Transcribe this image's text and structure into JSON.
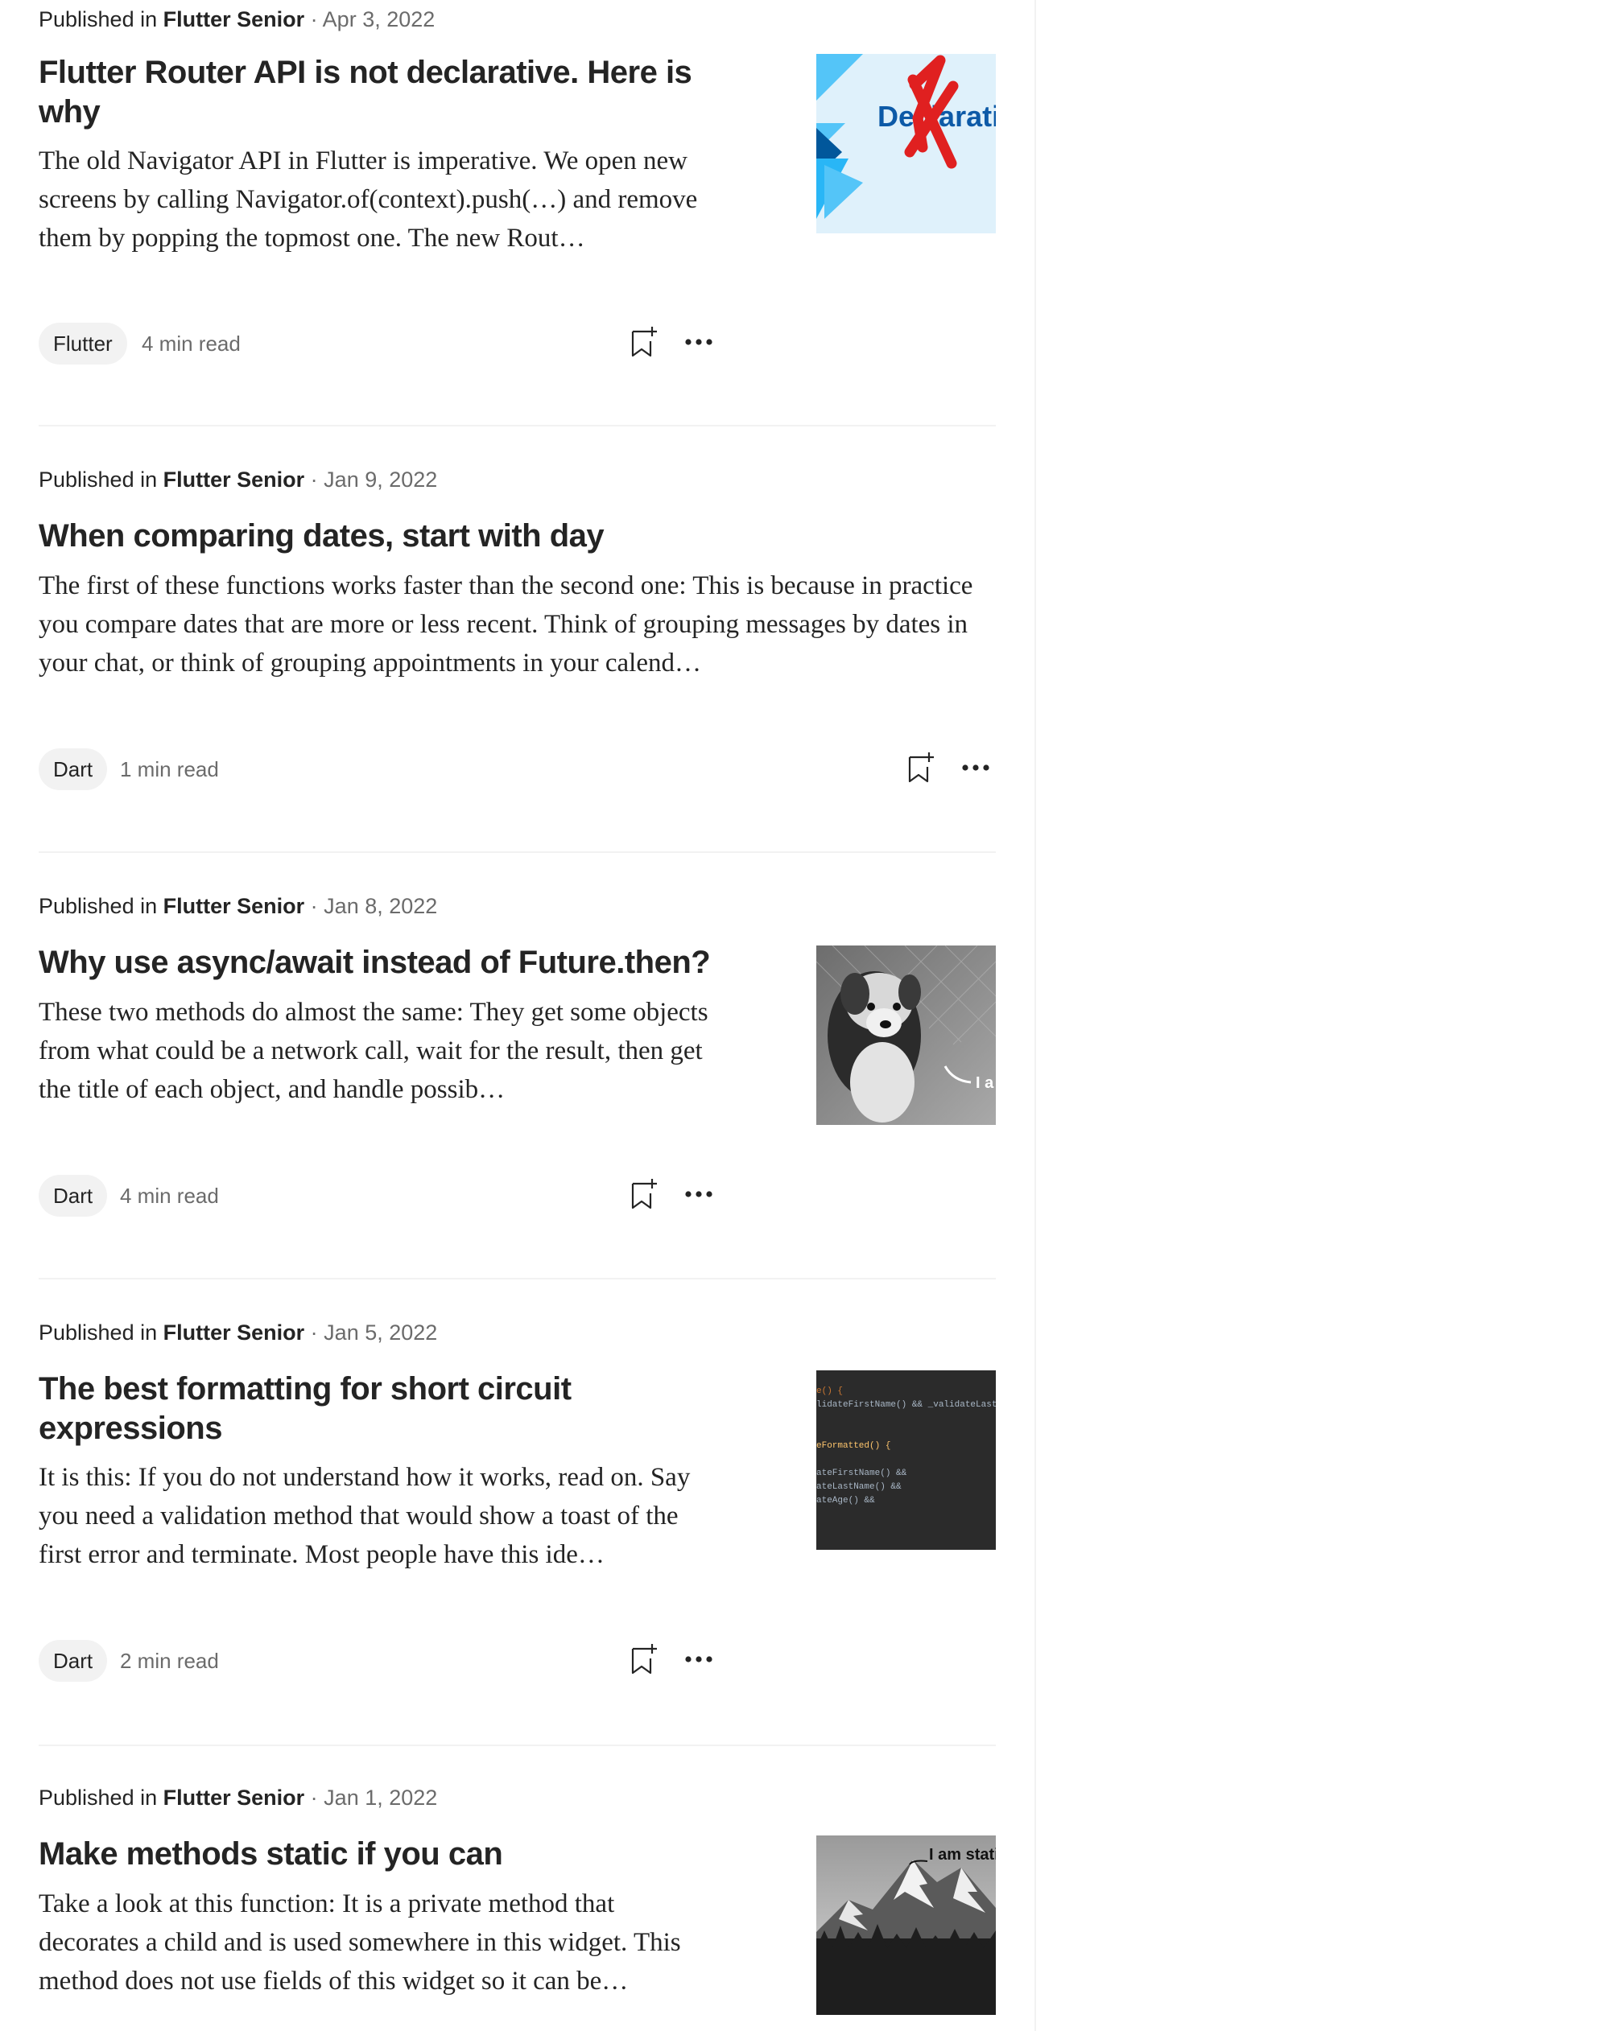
{
  "articles": [
    {
      "published_prefix": "Published in",
      "publication": "Flutter Senior",
      "separator": "·",
      "date": "Apr 3, 2022",
      "title": "Flutter Router API is not declarative. Here is why",
      "excerpt": "The old Navigator API in Flutter is imperative. We open new screens by calling Navigator.of(context).push(…) and remove them by popping the topmost one. The new Rout…",
      "tag": "Flutter",
      "read_time": "4 min read",
      "thumbnail_text": "Declarativ"
    },
    {
      "published_prefix": "Published in",
      "publication": "Flutter Senior",
      "separator": "·",
      "date": "Jan 9, 2022",
      "title": "When comparing dates, start with day",
      "excerpt": "The first of these functions works faster than the second one: This is because in practice you compare dates that are more or less recent. Think of grouping messages by dates in your chat, or think of grouping appointments in your calend…",
      "tag": "Dart",
      "read_time": "1 min read"
    },
    {
      "published_prefix": "Published in",
      "publication": "Flutter Senior",
      "separator": "·",
      "date": "Jan 8, 2022",
      "title": "Why use async/await instead of Future.then?",
      "excerpt": "These two methods do almost the same: They get some objects from what could be a network call, wait for the result, then get the title of each object, and handle possib…",
      "tag": "Dart",
      "read_time": "4 min read",
      "thumbnail_text": "I a"
    },
    {
      "published_prefix": "Published in",
      "publication": "Flutter Senior",
      "separator": "·",
      "date": "Jan 5, 2022",
      "title": "The best formatting for short circuit expressions",
      "excerpt": "It is this: If you do not understand how it works, read on. Say you need a validation method that would show a toast of the first error and terminate. Most people have this ide…",
      "tag": "Dart",
      "read_time": "2 min read",
      "thumbnail_code": [
        "e() {",
        "lidateFirstName() && _validateLast",
        "",
        "",
        "eFormatted() {",
        "",
        "ateFirstName() &&",
        "ateLastName() &&",
        "ateAge() &&"
      ]
    },
    {
      "published_prefix": "Published in",
      "publication": "Flutter Senior",
      "separator": "·",
      "date": "Jan 1, 2022",
      "title": "Make methods static if you can",
      "excerpt": "Take a look at this function: It is a private method that decorates a child and is used somewhere in this widget. This method does not use fields of this widget so it can be…",
      "thumbnail_text": "I am stati"
    }
  ],
  "colors": {
    "text": "#242424",
    "muted": "#6b6b6b",
    "tag_bg": "#f2f2f2",
    "divider": "#f2f2f2"
  }
}
